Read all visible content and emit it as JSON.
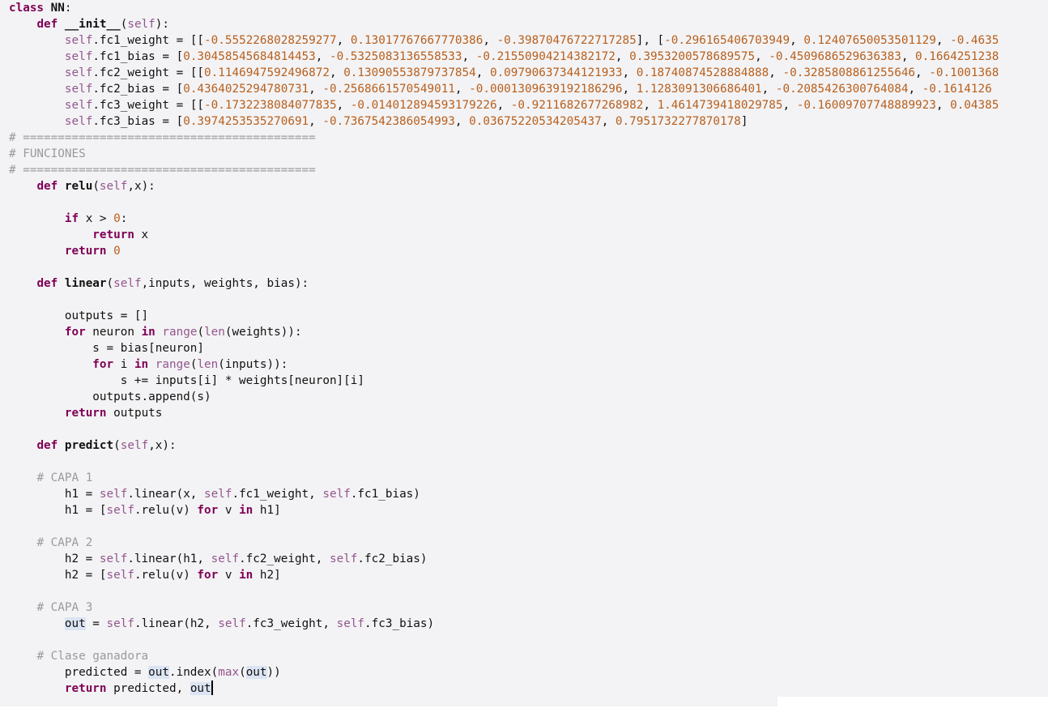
{
  "editor": {
    "language": "python",
    "colors": {
      "background": "#f3f3f5",
      "keyword": "#7f0055",
      "number": "#b85f1c",
      "self": "#94558d",
      "comment": "#9a9a9a",
      "highlight": "#dbe4f2"
    },
    "lines": [
      [
        [
          "kw",
          "class"
        ],
        [
          "plain",
          " "
        ],
        [
          "fn",
          "NN"
        ],
        [
          "plain",
          ":"
        ]
      ],
      [
        [
          "plain",
          "    "
        ],
        [
          "kw",
          "def"
        ],
        [
          "plain",
          " "
        ],
        [
          "fn",
          "__init__"
        ],
        [
          "plain",
          "("
        ],
        [
          "self",
          "self"
        ],
        [
          "plain",
          "):"
        ]
      ],
      [
        [
          "plain",
          "        "
        ],
        [
          "self",
          "self"
        ],
        [
          "plain",
          ".fc1_weight = [["
        ],
        [
          "num",
          "-0.5552268028259277"
        ],
        [
          "plain",
          ", "
        ],
        [
          "num",
          "0.13017767667770386"
        ],
        [
          "plain",
          ", "
        ],
        [
          "num",
          "-0.39870476722717285"
        ],
        [
          "plain",
          "], ["
        ],
        [
          "num",
          "-0.296165406703949"
        ],
        [
          "plain",
          ", "
        ],
        [
          "num",
          "0.12407650053501129"
        ],
        [
          "plain",
          ", "
        ],
        [
          "num",
          "-0.4635"
        ]
      ],
      [
        [
          "plain",
          "        "
        ],
        [
          "self",
          "self"
        ],
        [
          "plain",
          ".fc1_bias = ["
        ],
        [
          "num",
          "0.30458545684814453"
        ],
        [
          "plain",
          ", "
        ],
        [
          "num",
          "-0.5325083136558533"
        ],
        [
          "plain",
          ", "
        ],
        [
          "num",
          "-0.21550904214382172"
        ],
        [
          "plain",
          ", "
        ],
        [
          "num",
          "0.3953200578689575"
        ],
        [
          "plain",
          ", "
        ],
        [
          "num",
          "-0.4509686529636383"
        ],
        [
          "plain",
          ", "
        ],
        [
          "num",
          "0.1664251238"
        ]
      ],
      [
        [
          "plain",
          "        "
        ],
        [
          "self",
          "self"
        ],
        [
          "plain",
          ".fc2_weight = [["
        ],
        [
          "num",
          "0.1146947592496872"
        ],
        [
          "plain",
          ", "
        ],
        [
          "num",
          "0.13090553879737854"
        ],
        [
          "plain",
          ", "
        ],
        [
          "num",
          "0.09790637344121933"
        ],
        [
          "plain",
          ", "
        ],
        [
          "num",
          "0.18740874528884888"
        ],
        [
          "plain",
          ", "
        ],
        [
          "num",
          "-0.3285808861255646"
        ],
        [
          "plain",
          ", "
        ],
        [
          "num",
          "-0.1001368"
        ]
      ],
      [
        [
          "plain",
          "        "
        ],
        [
          "self",
          "self"
        ],
        [
          "plain",
          ".fc2_bias = ["
        ],
        [
          "num",
          "0.4364025294780731"
        ],
        [
          "plain",
          ", "
        ],
        [
          "num",
          "-0.2568661570549011"
        ],
        [
          "plain",
          ", "
        ],
        [
          "num",
          "-0.0001309639192186296"
        ],
        [
          "plain",
          ", "
        ],
        [
          "num",
          "1.1283091306686401"
        ],
        [
          "plain",
          ", "
        ],
        [
          "num",
          "-0.2085426300764084"
        ],
        [
          "plain",
          ", "
        ],
        [
          "num",
          "-0.1614126"
        ]
      ],
      [
        [
          "plain",
          "        "
        ],
        [
          "self",
          "self"
        ],
        [
          "plain",
          ".fc3_weight = [["
        ],
        [
          "num",
          "-0.1732238084077835"
        ],
        [
          "plain",
          ", "
        ],
        [
          "num",
          "-0.014012894593179226"
        ],
        [
          "plain",
          ", "
        ],
        [
          "num",
          "-0.9211682677268982"
        ],
        [
          "plain",
          ", "
        ],
        [
          "num",
          "1.4614739418029785"
        ],
        [
          "plain",
          ", "
        ],
        [
          "num",
          "-0.16009707748889923"
        ],
        [
          "plain",
          ", "
        ],
        [
          "num",
          "0.04385"
        ]
      ],
      [
        [
          "plain",
          "        "
        ],
        [
          "self",
          "self"
        ],
        [
          "plain",
          ".fc3_bias = ["
        ],
        [
          "num",
          "0.3974253535270691"
        ],
        [
          "plain",
          ", "
        ],
        [
          "num",
          "-0.7367542386054993"
        ],
        [
          "plain",
          ", "
        ],
        [
          "num",
          "0.03675220534205437"
        ],
        [
          "plain",
          ", "
        ],
        [
          "num",
          "0.7951732277870178"
        ],
        [
          "plain",
          "]"
        ]
      ],
      [
        [
          "comment",
          "# =========================================="
        ]
      ],
      [
        [
          "comment",
          "# FUNCIONES"
        ]
      ],
      [
        [
          "comment",
          "# =========================================="
        ]
      ],
      [
        [
          "plain",
          "    "
        ],
        [
          "kw",
          "def"
        ],
        [
          "plain",
          " "
        ],
        [
          "fn",
          "relu"
        ],
        [
          "plain",
          "("
        ],
        [
          "self",
          "self"
        ],
        [
          "plain",
          ",x):"
        ]
      ],
      [],
      [
        [
          "plain",
          "        "
        ],
        [
          "kw",
          "if"
        ],
        [
          "plain",
          " x > "
        ],
        [
          "num",
          "0"
        ],
        [
          "plain",
          ":"
        ]
      ],
      [
        [
          "plain",
          "            "
        ],
        [
          "kw",
          "return"
        ],
        [
          "plain",
          " x"
        ]
      ],
      [
        [
          "plain",
          "        "
        ],
        [
          "kw",
          "return"
        ],
        [
          "plain",
          " "
        ],
        [
          "num",
          "0"
        ]
      ],
      [],
      [
        [
          "plain",
          "    "
        ],
        [
          "kw",
          "def"
        ],
        [
          "plain",
          " "
        ],
        [
          "fn",
          "linear"
        ],
        [
          "plain",
          "("
        ],
        [
          "self",
          "self"
        ],
        [
          "plain",
          ",inputs, weights, bias):"
        ]
      ],
      [],
      [
        [
          "plain",
          "        outputs = []"
        ]
      ],
      [
        [
          "plain",
          "        "
        ],
        [
          "kw",
          "for"
        ],
        [
          "plain",
          " neuron "
        ],
        [
          "kw",
          "in"
        ],
        [
          "plain",
          " "
        ],
        [
          "builtin",
          "range"
        ],
        [
          "plain",
          "("
        ],
        [
          "builtin",
          "len"
        ],
        [
          "plain",
          "(weights)):"
        ]
      ],
      [
        [
          "plain",
          "            s = bias[neuron]"
        ]
      ],
      [
        [
          "plain",
          "            "
        ],
        [
          "kw",
          "for"
        ],
        [
          "plain",
          " i "
        ],
        [
          "kw",
          "in"
        ],
        [
          "plain",
          " "
        ],
        [
          "builtin",
          "range"
        ],
        [
          "plain",
          "("
        ],
        [
          "builtin",
          "len"
        ],
        [
          "plain",
          "(inputs)):"
        ]
      ],
      [
        [
          "plain",
          "                s += inputs[i] * weights[neuron][i]"
        ]
      ],
      [
        [
          "plain",
          "            outputs.append(s)"
        ]
      ],
      [
        [
          "plain",
          "        "
        ],
        [
          "kw",
          "return"
        ],
        [
          "plain",
          " outputs"
        ]
      ],
      [],
      [
        [
          "plain",
          "    "
        ],
        [
          "kw",
          "def"
        ],
        [
          "plain",
          " "
        ],
        [
          "fn",
          "predict"
        ],
        [
          "plain",
          "("
        ],
        [
          "self",
          "self"
        ],
        [
          "plain",
          ",x):"
        ]
      ],
      [],
      [
        [
          "plain",
          "    "
        ],
        [
          "comment",
          "# CAPA 1"
        ]
      ],
      [
        [
          "plain",
          "        h1 = "
        ],
        [
          "self",
          "self"
        ],
        [
          "plain",
          ".linear(x, "
        ],
        [
          "self",
          "self"
        ],
        [
          "plain",
          ".fc1_weight, "
        ],
        [
          "self",
          "self"
        ],
        [
          "plain",
          ".fc1_bias)"
        ]
      ],
      [
        [
          "plain",
          "        h1 = ["
        ],
        [
          "self",
          "self"
        ],
        [
          "plain",
          ".relu(v) "
        ],
        [
          "kw",
          "for"
        ],
        [
          "plain",
          " v "
        ],
        [
          "kw",
          "in"
        ],
        [
          "plain",
          " h1]"
        ]
      ],
      [],
      [
        [
          "plain",
          "    "
        ],
        [
          "comment",
          "# CAPA 2"
        ]
      ],
      [
        [
          "plain",
          "        h2 = "
        ],
        [
          "self",
          "self"
        ],
        [
          "plain",
          ".linear(h1, "
        ],
        [
          "self",
          "self"
        ],
        [
          "plain",
          ".fc2_weight, "
        ],
        [
          "self",
          "self"
        ],
        [
          "plain",
          ".fc2_bias)"
        ]
      ],
      [
        [
          "plain",
          "        h2 = ["
        ],
        [
          "self",
          "self"
        ],
        [
          "plain",
          ".relu(v) "
        ],
        [
          "kw",
          "for"
        ],
        [
          "plain",
          " v "
        ],
        [
          "kw",
          "in"
        ],
        [
          "plain",
          " h2]"
        ]
      ],
      [],
      [
        [
          "plain",
          "    "
        ],
        [
          "comment",
          "# CAPA 3"
        ]
      ],
      [
        [
          "plain",
          "        "
        ],
        [
          "hl",
          "out"
        ],
        [
          "plain",
          " = "
        ],
        [
          "self",
          "self"
        ],
        [
          "plain",
          ".linear(h2, "
        ],
        [
          "self",
          "self"
        ],
        [
          "plain",
          ".fc3_weight, "
        ],
        [
          "self",
          "self"
        ],
        [
          "plain",
          ".fc3_bias)"
        ]
      ],
      [],
      [
        [
          "plain",
          "    "
        ],
        [
          "comment",
          "# Clase ganadora"
        ]
      ],
      [
        [
          "plain",
          "        predicted = "
        ],
        [
          "hl",
          "out"
        ],
        [
          "plain",
          ".index("
        ],
        [
          "builtin",
          "max"
        ],
        [
          "plain",
          "("
        ],
        [
          "hl",
          "out"
        ],
        [
          "plain",
          "))"
        ]
      ],
      [
        [
          "plain",
          "        "
        ],
        [
          "kw",
          "return"
        ],
        [
          "plain",
          " predicted, "
        ],
        [
          "hl",
          "out"
        ]
      ]
    ]
  }
}
